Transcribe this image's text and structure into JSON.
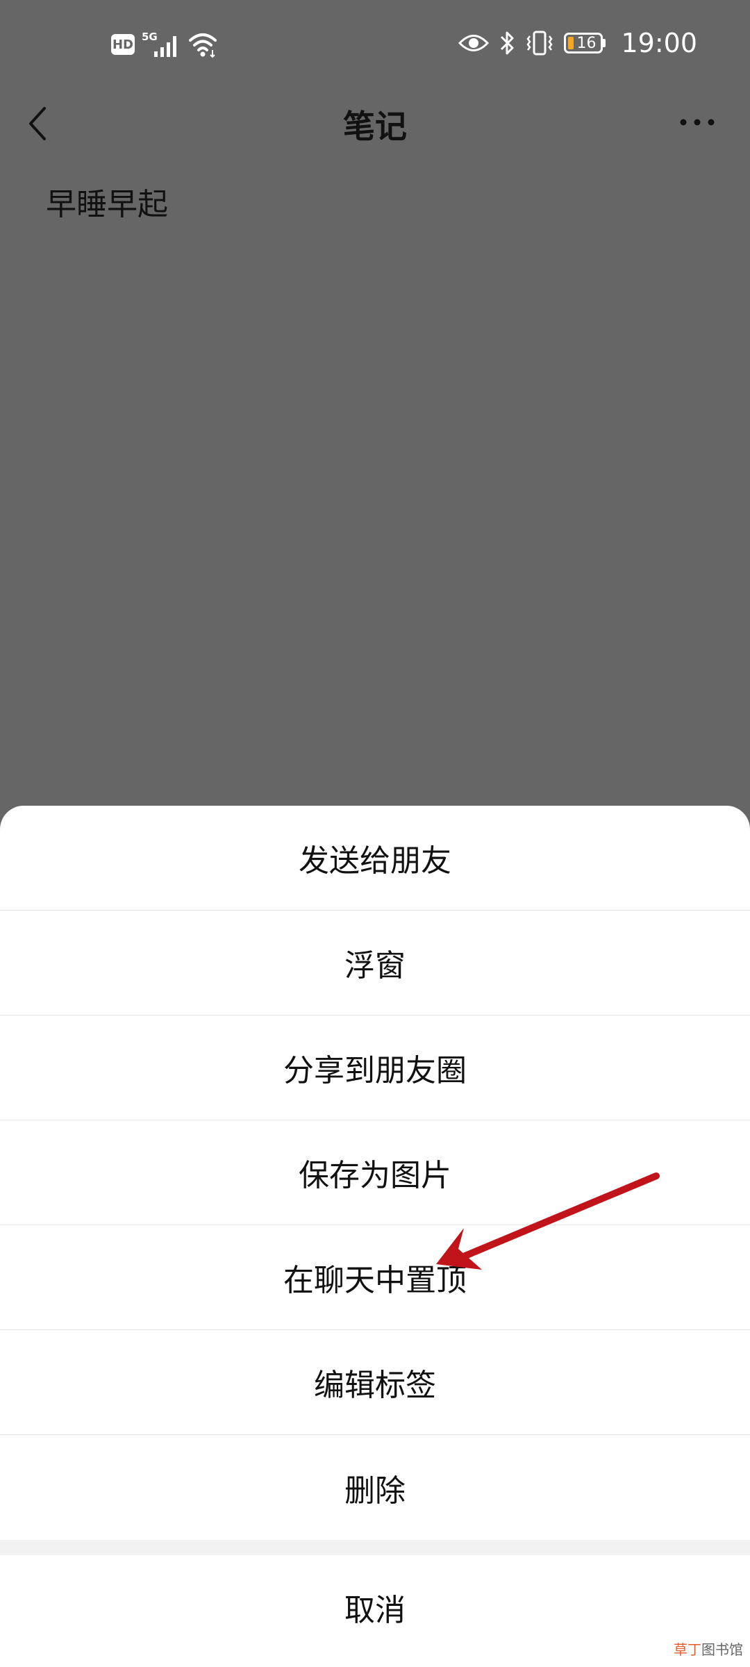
{
  "status_bar": {
    "hd_label": "HD",
    "network_label": "5G",
    "battery_level": "16",
    "time": "19:00"
  },
  "header": {
    "title": "笔记",
    "back_icon": "chevron-left-icon",
    "more_icon": "more-horizontal-icon"
  },
  "note": {
    "content": "早睡早起"
  },
  "action_sheet": {
    "items": [
      {
        "label": "发送给朋友"
      },
      {
        "label": "浮窗"
      },
      {
        "label": "分享到朋友圈"
      },
      {
        "label": "保存为图片"
      },
      {
        "label": "在聊天中置顶"
      },
      {
        "label": "编辑标签"
      },
      {
        "label": "删除"
      }
    ],
    "cancel_label": "取消"
  },
  "annotation": {
    "arrow_color": "#c0141a",
    "arrow_target": "在聊天中置顶"
  },
  "watermark": {
    "accent": "草丁",
    "rest": "图书馆"
  },
  "colors": {
    "overlay_bg": "#666666",
    "sheet_bg": "#ffffff",
    "battery_fill": "#f5a623"
  }
}
